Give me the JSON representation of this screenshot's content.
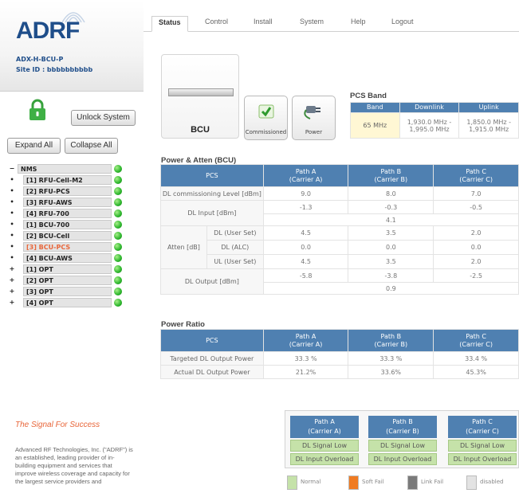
{
  "brand": {
    "logo_text": "AD",
    "logo_text_rf": "RF",
    "device_name": "ADX-H-BCU-P",
    "site_id": "Site ID : bbbbbbbbbb"
  },
  "sidebar": {
    "unlock_label": "Unlock System",
    "expand_label": "Expand All",
    "collapse_label": "Collapse All",
    "tree": [
      {
        "sign": "−",
        "label": "NMS",
        "level": "root",
        "selected": false
      },
      {
        "sign": "•",
        "label": "[1] RFU-Cell-M2",
        "level": "child",
        "selected": false
      },
      {
        "sign": "•",
        "label": "[2] RFU-PCS",
        "level": "child",
        "selected": false
      },
      {
        "sign": "•",
        "label": "[3] RFU-AWS",
        "level": "child",
        "selected": false
      },
      {
        "sign": "•",
        "label": "[4] RFU-700",
        "level": "child",
        "selected": false
      },
      {
        "sign": "•",
        "label": "[1] BCU-700",
        "level": "child",
        "selected": false
      },
      {
        "sign": "•",
        "label": "[2] BCU-Cell",
        "level": "child",
        "selected": false
      },
      {
        "sign": "•",
        "label": "[3] BCU-PCS",
        "level": "child",
        "selected": true
      },
      {
        "sign": "•",
        "label": "[4] BCU-AWS",
        "level": "child",
        "selected": false
      },
      {
        "sign": "+",
        "label": "[1] OPT",
        "level": "child",
        "selected": false
      },
      {
        "sign": "+",
        "label": "[2] OPT",
        "level": "child",
        "selected": false
      },
      {
        "sign": "+",
        "label": "[3] OPT",
        "level": "child",
        "selected": false
      },
      {
        "sign": "+",
        "label": "[4] OPT",
        "level": "child",
        "selected": false
      }
    ],
    "tagline": "The Signal For Success",
    "about": "Advanced RF Technologies, Inc. (\"ADRF\") is an established, leading provider of in-building equipment and services that improve wireless coverage and capacity for the largest service providers and"
  },
  "nav": {
    "tabs": [
      "Status",
      "Control",
      "Install",
      "System",
      "Help",
      "Logout"
    ]
  },
  "status": {
    "device_label": "BCU",
    "commissioned_label": "Commissioned",
    "power_label": "Power",
    "pcs_band": {
      "title": "PCS Band",
      "headers": [
        "Band",
        "Downlink",
        "Uplink"
      ],
      "band": "65 MHz",
      "downlink": [
        "1,930.0 MHz -",
        "1,995.0 MHz"
      ],
      "uplink": [
        "1,850.0 MHz -",
        "1,915.0 MHz"
      ]
    },
    "power_atten": {
      "title": "Power & Atten (BCU)",
      "col_pcs": "PCS",
      "col_a": [
        "Path A",
        "(Carrier A)"
      ],
      "col_b": [
        "Path B",
        "(Carrier B)"
      ],
      "col_c": [
        "Path C",
        "(Carrier C)"
      ],
      "dl_comm_label": "DL commissioning Level [dBm]",
      "dl_comm": [
        "9.0",
        "8.0",
        "7.0"
      ],
      "dl_input_label": "DL Input [dBm]",
      "dl_input": [
        "-1.3",
        "-0.3",
        "-0.5"
      ],
      "dl_input_total": "4.1",
      "atten_label": "Atten [dB]",
      "dl_user_label": "DL (User Set)",
      "dl_user": [
        "4.5",
        "3.5",
        "2.0"
      ],
      "dl_alc_label": "DL (ALC)",
      "dl_alc": [
        "0.0",
        "0.0",
        "0.0"
      ],
      "ul_user_label": "UL (User Set)",
      "ul_user": [
        "4.5",
        "3.5",
        "2.0"
      ],
      "dl_output_label": "DL Output [dBm]",
      "dl_output": [
        "-5.8",
        "-3.8",
        "-2.5"
      ],
      "dl_output_total": "0.9"
    },
    "power_ratio": {
      "title": "Power Ratio",
      "col_pcs": "PCS",
      "targeted_label": "Targeted DL Output Power",
      "targeted": [
        "33.3 %",
        "33.3 %",
        "33.4 %"
      ],
      "actual_label": "Actual DL Output Power",
      "actual": [
        "21.2%",
        "33.6%",
        "45.3%"
      ]
    },
    "path_status": [
      {
        "head": [
          "Path A",
          "(Carrier A)"
        ],
        "s1": "DL Signal Low",
        "s2": "DL Input Overload"
      },
      {
        "head": [
          "Path B",
          "(Carrier B)"
        ],
        "s1": "DL Signal Low",
        "s2": "DL Input Overload"
      },
      {
        "head": [
          "Path C",
          "(Carrier C)"
        ],
        "s1": "DL Signal Low",
        "s2": "DL Input Overload"
      }
    ],
    "legend": [
      {
        "label": "Normal",
        "color": "#c5e2a9"
      },
      {
        "label": "Soft Fail",
        "color": "#f07b22"
      },
      {
        "label": "Link Fail",
        "color": "#7a7a7a"
      },
      {
        "label": "disabled",
        "color": "#e3e3e3"
      }
    ]
  }
}
